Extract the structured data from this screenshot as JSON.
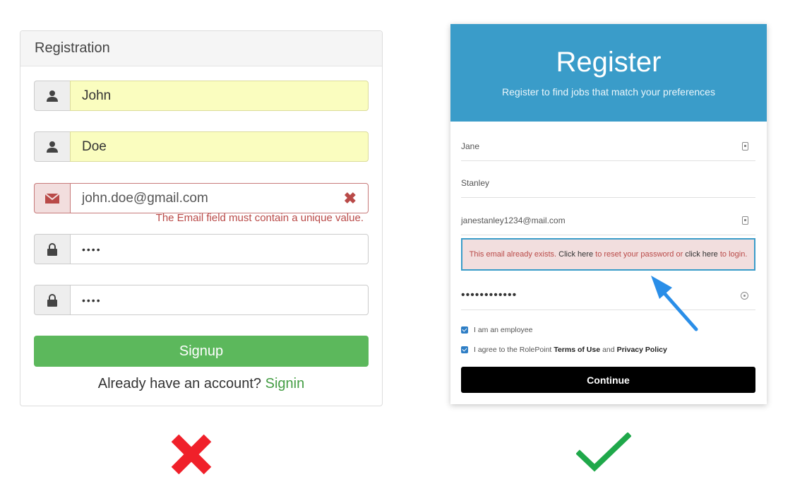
{
  "left": {
    "header": "Registration",
    "first_name": "John",
    "last_name": "Doe",
    "email": "john.doe@gmail.com",
    "email_error": "The Email field must contain a unique value.",
    "password": "••••",
    "confirm_password": "••••",
    "signup_label": "Signup",
    "already_text": "Already have an account?",
    "signin_label": "Signin",
    "icons": [
      "user-icon",
      "user-icon",
      "envelope-icon",
      "lock-icon",
      "lock-icon",
      "error-x-icon"
    ],
    "colors": {
      "button": "#5cb85c",
      "error": "#b94a48",
      "autofill": "#fafdbf"
    }
  },
  "right": {
    "title": "Register",
    "subtitle": "Register to find jobs that match your preferences",
    "first_name": "Jane",
    "last_name": "Stanley",
    "email": "janestanley1234@mail.com",
    "alert": {
      "part1": "This email already exists.",
      "link1": "Click here",
      "part2": "to reset your password or",
      "link2": "click here",
      "part3": "to login."
    },
    "password": "••••••••••••",
    "employee_label": "I am an employee",
    "agree_prefix": "I agree to the RolePoint",
    "terms_label": "Terms of Use",
    "and_label": "and",
    "privacy_label": "Privacy Policy",
    "continue_label": "Continue",
    "colors": {
      "header": "#3a9cc9",
      "button": "#000000",
      "arrow": "#2a8ee8"
    }
  },
  "verdicts": {
    "bad": "red-x-icon",
    "good": "green-check-icon"
  }
}
